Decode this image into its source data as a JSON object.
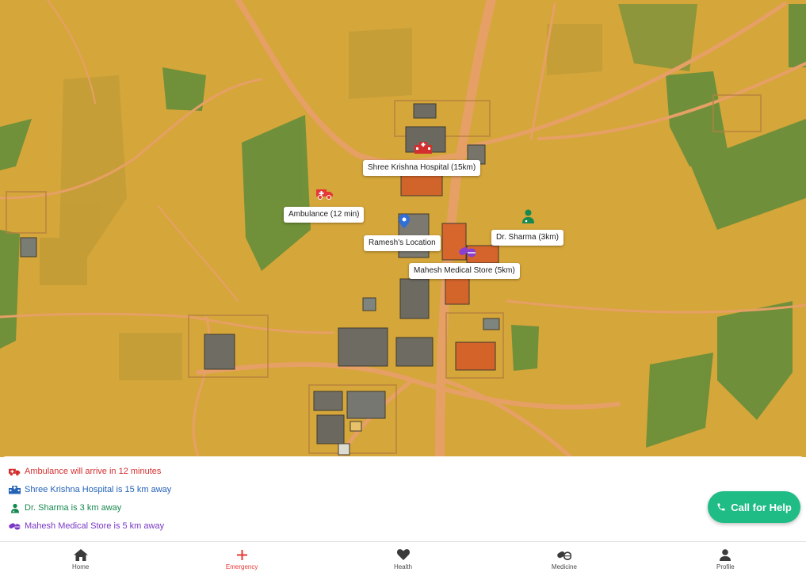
{
  "map": {
    "labels": {
      "hospital": "Shree Krishna Hospital (15km)",
      "ambulance": "Ambulance (12 min)",
      "location": "Ramesh's Location",
      "doctor": "Dr. Sharma (3km)",
      "medical_store": "Mahesh Medical Store (5km)"
    },
    "pins": {
      "hospital_icon": "hospital-icon",
      "ambulance_icon": "ambulance-icon",
      "location_icon": "map-pin-icon",
      "doctor_icon": "doctor-icon",
      "medical_store_icon": "pills-icon"
    }
  },
  "info": {
    "ambulance": "Ambulance will arrive in 12 minutes",
    "hospital": "Shree Krishna Hospital is 15 km away",
    "doctor": "Dr. Sharma is 3 km away",
    "medical_store": "Mahesh Medical Store is 5 km away"
  },
  "call_button": {
    "label": "Call for Help",
    "icon": "phone-icon"
  },
  "nav": {
    "items": [
      {
        "label": "Home",
        "icon": "home-icon"
      },
      {
        "label": "Emergency",
        "icon": "plus-icon",
        "active": true
      },
      {
        "label": "Health",
        "icon": "heart-icon"
      },
      {
        "label": "Medicine",
        "icon": "pills-icon"
      },
      {
        "label": "Profile",
        "icon": "user-icon"
      }
    ]
  },
  "colors": {
    "ambulance": "#d32f2f",
    "hospital": "#2563b8",
    "doctor": "#16894f",
    "medical_store": "#7a37c6",
    "call_button": "#1fbc85",
    "nav_active": "#e53935"
  }
}
